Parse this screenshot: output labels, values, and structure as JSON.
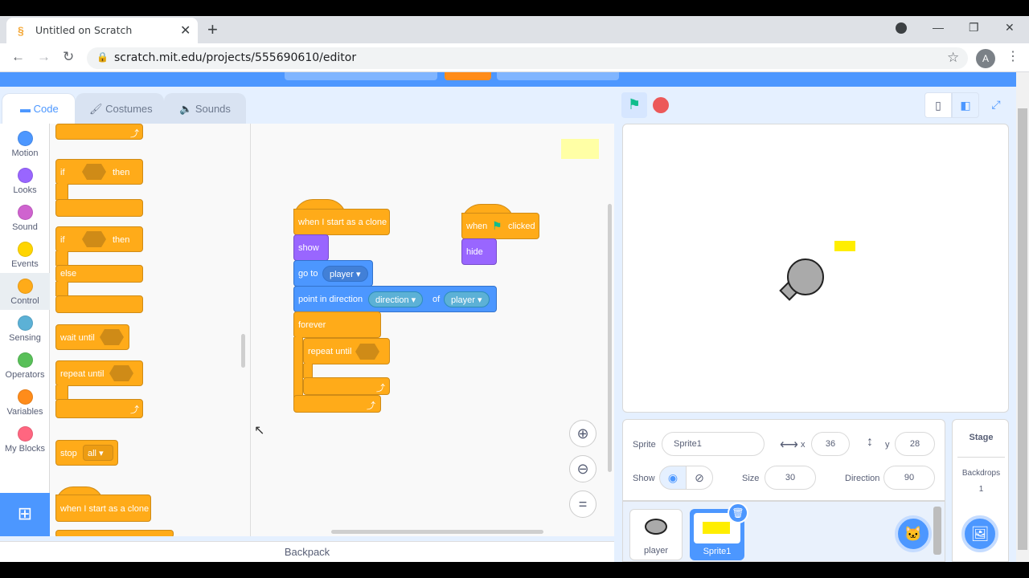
{
  "browser": {
    "tab_title": "Untitled on Scratch",
    "url": "scratch.mit.edu/projects/555690610/editor",
    "avatar_letter": "A"
  },
  "editor_tabs": [
    {
      "label": "Code"
    },
    {
      "label": "Costumes"
    },
    {
      "label": "Sounds"
    }
  ],
  "categories": [
    {
      "label": "Motion",
      "color": "#4c97ff"
    },
    {
      "label": "Looks",
      "color": "#9966ff"
    },
    {
      "label": "Sound",
      "color": "#cf63cf"
    },
    {
      "label": "Events",
      "color": "#ffd500"
    },
    {
      "label": "Control",
      "color": "#ffab19"
    },
    {
      "label": "Sensing",
      "color": "#5cb1d6"
    },
    {
      "label": "Operators",
      "color": "#59c059"
    },
    {
      "label": "Variables",
      "color": "#ff8c1a"
    },
    {
      "label": "My Blocks",
      "color": "#ff6680"
    }
  ],
  "palette": {
    "if_then": {
      "if": "if",
      "then": "then"
    },
    "if_else": {
      "if": "if",
      "then": "then",
      "else": "else"
    },
    "wait_until": "wait until",
    "repeat_until": "repeat until",
    "stop": {
      "label": "stop",
      "option": "all"
    },
    "clone_hat": "when I start as a clone"
  },
  "script1": {
    "hat": "when I start as a clone",
    "show": "show",
    "goto": {
      "label": "go to",
      "target": "player"
    },
    "point": {
      "label": "point in direction",
      "attr": "direction",
      "of": "of",
      "obj": "player"
    },
    "forever": "forever",
    "repeat_until": "repeat until"
  },
  "script2": {
    "when": "when",
    "clicked": "clicked",
    "hide": "hide"
  },
  "backpack": "Backpack",
  "sprite_info": {
    "sprite_label": "Sprite",
    "sprite_name": "Sprite1",
    "x_label": "x",
    "x": "36",
    "y_label": "y",
    "y": "28",
    "show_label": "Show",
    "size_label": "Size",
    "size": "30",
    "direction_label": "Direction",
    "direction": "90"
  },
  "sprites": [
    {
      "name": "player"
    },
    {
      "name": "Sprite1"
    }
  ],
  "stage_panel": {
    "label": "Stage",
    "backdrops_label": "Backdrops",
    "backdrops_count": "1"
  },
  "colors": {
    "accent": "#4c97ff",
    "control": "#ffab19",
    "looks": "#9966ff",
    "sprite_yellow": "#ffee00"
  }
}
